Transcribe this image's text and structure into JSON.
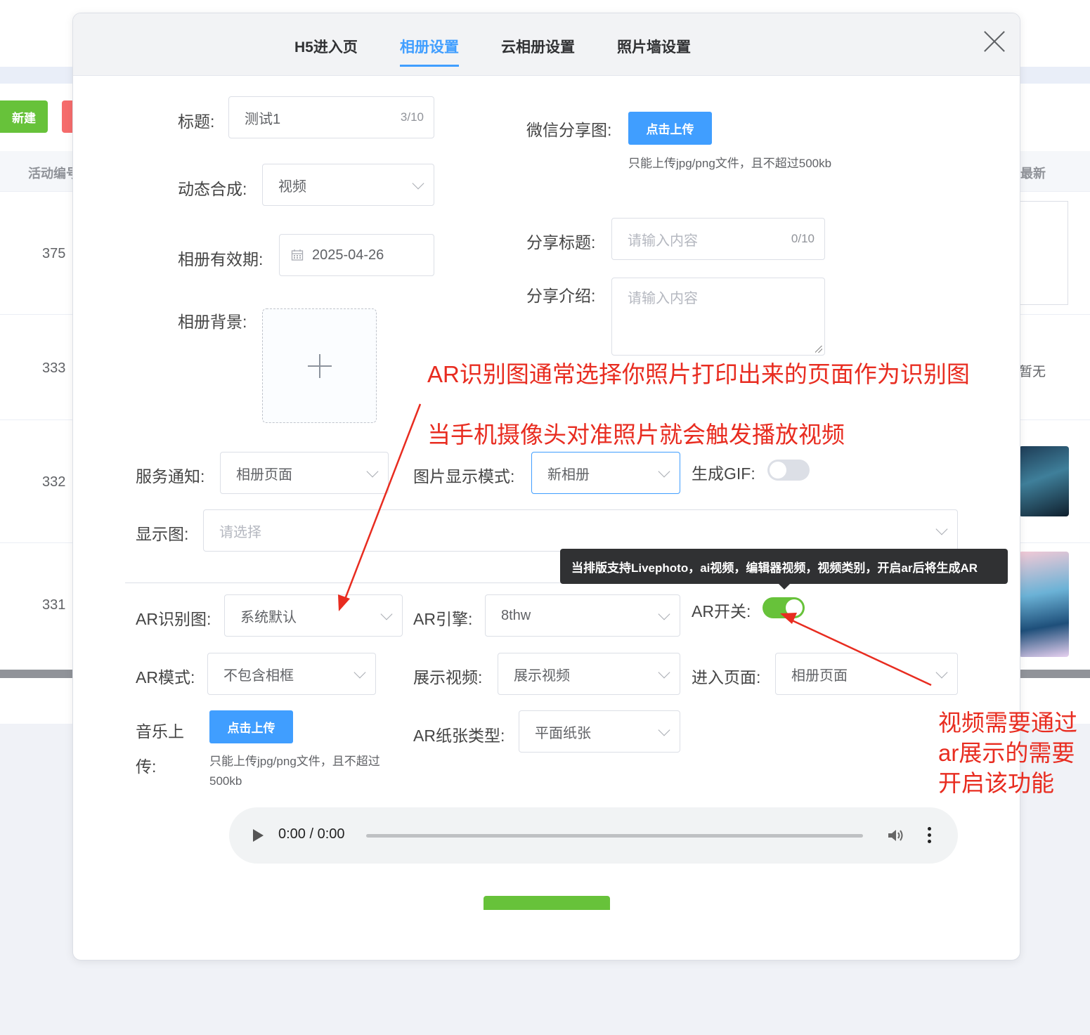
{
  "background": {
    "new_button": "新建",
    "col_activity_id": "活动编号",
    "col_latest": "最新",
    "row_ids": [
      "375",
      "333",
      "332",
      "331"
    ],
    "empty_text": "暂无"
  },
  "tabs": [
    {
      "label": "H5进入页"
    },
    {
      "label": "相册设置"
    },
    {
      "label": "云相册设置"
    },
    {
      "label": "照片墙设置"
    }
  ],
  "active_tab": "相册设置",
  "form": {
    "title_label": "标题:",
    "title_value": "测试1",
    "title_count": "3/10",
    "wechat_share_label": "微信分享图:",
    "upload_button": "点击上传",
    "upload_hint": "只能上传jpg/png文件，且不超过500kb",
    "dynamic_label": "动态合成:",
    "dynamic_value": "视频",
    "validity_label": "相册有效期:",
    "validity_value": "2025-04-26",
    "share_title_label": "分享标题:",
    "share_title_placeholder": "请输入内容",
    "share_title_count": "0/10",
    "share_intro_label": "分享介绍:",
    "share_intro_placeholder": "请输入内容",
    "bg_label": "相册背景:",
    "notify_label": "服务通知:",
    "notify_value": "相册页面",
    "display_mode_label": "图片显示模式:",
    "display_mode_value": "新相册",
    "gif_label": "生成GIF:",
    "gif_on": false,
    "display_img_label": "显示图:",
    "display_img_placeholder": "请选择",
    "tooltip": "当排版支持Livephoto，ai视频，编辑器视频，视频类别，开启ar后将生成AR",
    "ar_img_label": "AR识别图:",
    "ar_img_value": "系统默认",
    "ar_engine_label": "AR引擎:",
    "ar_engine_value": "8thw",
    "ar_switch_label": "AR开关:",
    "ar_on": true,
    "ar_mode_label": "AR模式:",
    "ar_mode_value": "不包含相框",
    "show_video_label": "展示视频:",
    "show_video_value": "展示视频",
    "enter_page_label": "进入页面:",
    "enter_page_value": "相册页面",
    "music_label_1": "音乐上",
    "music_label_2": "传:",
    "music_upload_button": "点击上传",
    "music_hint_1": "只能上传jpg/png文件，且不超过",
    "music_hint_2": "500kb",
    "paper_label": "AR纸张类型:",
    "paper_value": "平面纸张",
    "audio_time": "0:00 / 0:00"
  },
  "annotations": {
    "line1": "AR识别图通常选择你照片打印出来的页面作为识别图",
    "line2": "当手机摄像头对准照片就会触发播放视频",
    "note_1": "视频需要通过",
    "note_2": "ar展示的需要",
    "note_3": "开启该功能",
    "color": "#e82c20"
  },
  "colors": {
    "primary": "#409eff",
    "success": "#67c23a"
  }
}
